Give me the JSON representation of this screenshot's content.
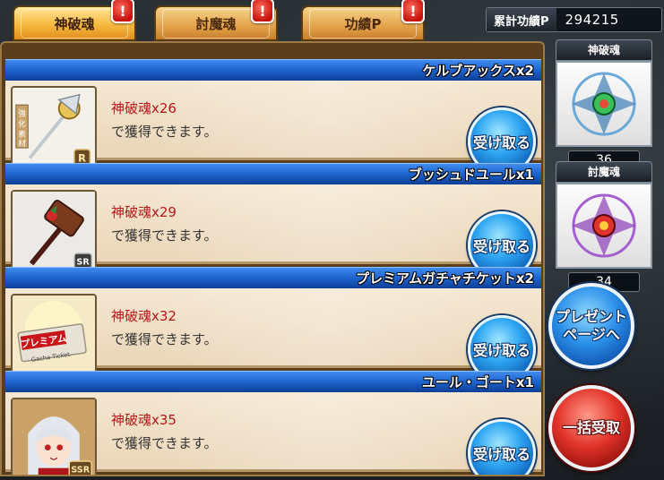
{
  "tabs": [
    {
      "label": "神破魂",
      "active": true,
      "alert": "!"
    },
    {
      "label": "討魔魂",
      "active": false,
      "alert": "!"
    },
    {
      "label": "功績P",
      "active": false,
      "alert": "!"
    }
  ],
  "points": {
    "label": "累計功績P",
    "value": "294215"
  },
  "rewards": [
    {
      "name": "ケルブアックスx2",
      "requirement": "神破魂x26",
      "note": "で獲得できます。",
      "button": "受け取る",
      "thumb_icon": "axe-icon",
      "badge": "R"
    },
    {
      "name": "ブッシュドユールx1",
      "requirement": "神破魂x29",
      "note": "で獲得できます。",
      "button": "受け取る",
      "thumb_icon": "hammer-icon",
      "badge": "SR"
    },
    {
      "name": "プレミアムガチャチケットx2",
      "requirement": "神破魂x32",
      "note": "で獲得できます。",
      "button": "受け取る",
      "thumb_icon": "ticket-icon",
      "ticket_text": "プレミアム",
      "ticket_sub": "Gacha Ticket"
    },
    {
      "name": "ユール・ゴートx1",
      "requirement": "神破魂x35",
      "note": "で獲得できます。",
      "button": "受け取る",
      "thumb_icon": "character-portrait-icon",
      "badge": "SSR"
    }
  ],
  "thumb_tag": "強化素材",
  "souls": [
    {
      "title": "神破魂",
      "count": "36",
      "icon": "shinpa-soul-icon"
    },
    {
      "title": "討魔魂",
      "count": "34",
      "icon": "toma-soul-icon"
    }
  ],
  "buttons": {
    "present": "プレゼント\nページへ",
    "receive_all": "一括受取"
  },
  "colors": {
    "accent_blue": "#1b5fc9",
    "tab_gold": "#f7b940",
    "req_red": "#b8161b"
  }
}
